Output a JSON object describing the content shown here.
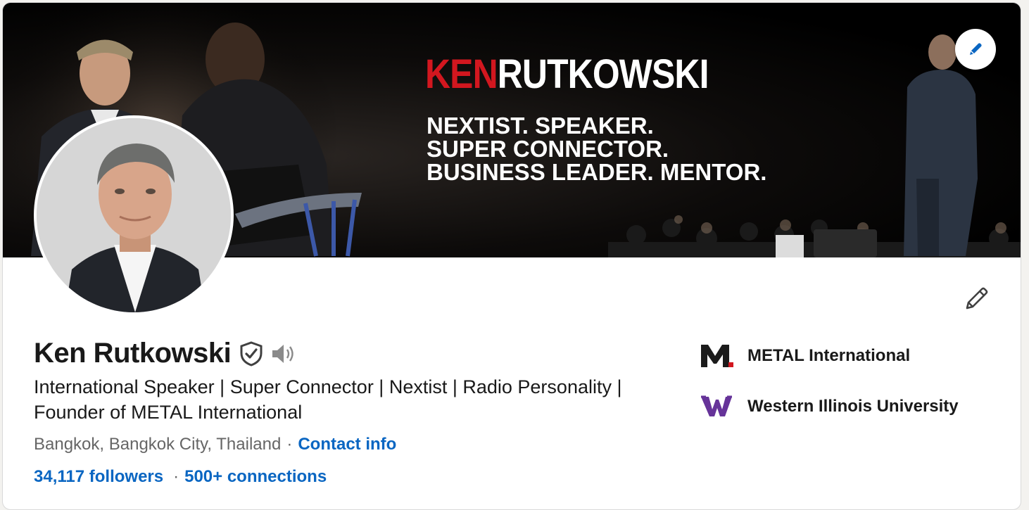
{
  "banner": {
    "title_first": "KEN",
    "title_last": "RUTKOWSKI",
    "taglines": [
      "NEXTIST. SPEAKER.",
      "SUPER CONNECTOR.",
      "BUSINESS LEADER. MENTOR."
    ],
    "title_accent_color": "#d2171f",
    "edit_icon": "pencil-icon"
  },
  "profile": {
    "name": "Ken Rutkowski",
    "verified_icon": "shield-check-icon",
    "pronunciation_icon": "speaker-icon",
    "headline": "International Speaker | Super Connector | Nextist | Radio Personality | Founder of METAL International",
    "location": "Bangkok, Bangkok City, Thailand",
    "separator": "·",
    "contact_info": "Contact info",
    "followers": "34,117 followers",
    "connections": "500+ connections",
    "edit_icon": "pencil-icon"
  },
  "organizations": [
    {
      "logo_text": "M",
      "name": "METAL International",
      "logo_color": "#1b1b1b",
      "accent": "#d2171f"
    },
    {
      "logo_text": "W",
      "name": "Western Illinois University",
      "logo_color": "#663399"
    }
  ],
  "colors": {
    "link": "#0a66c2",
    "text": "#191919",
    "muted": "#666666"
  }
}
